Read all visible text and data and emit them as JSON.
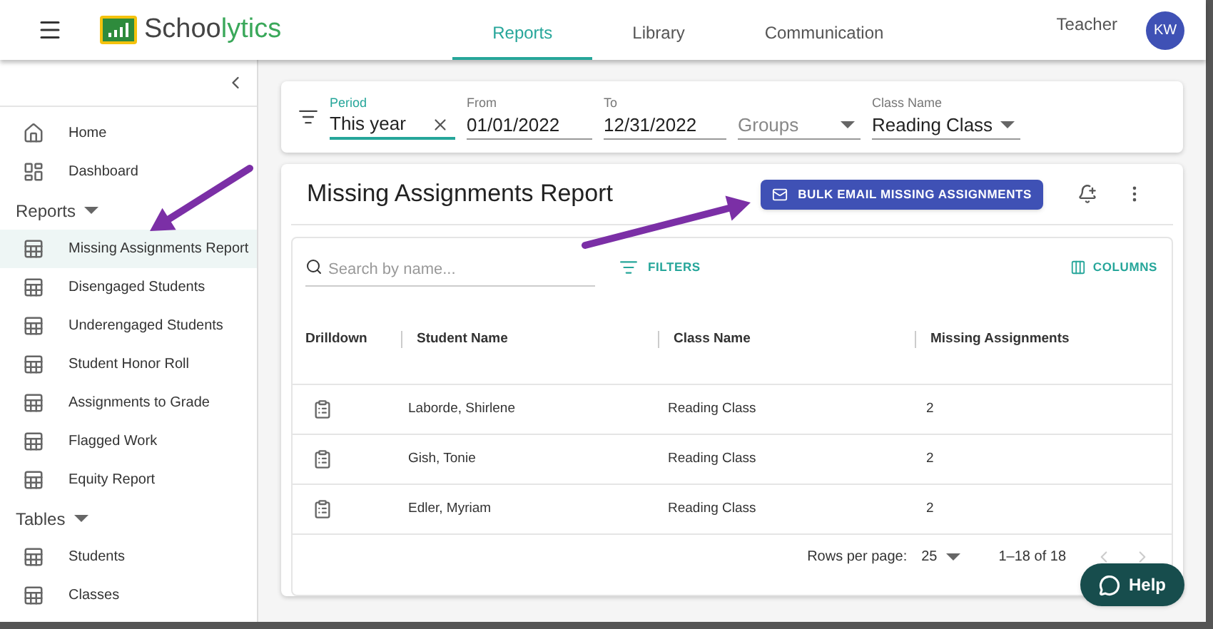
{
  "header": {
    "logo_parts": [
      "Schoo",
      "lytics"
    ],
    "tabs": [
      {
        "label": "Reports",
        "selected": true
      },
      {
        "label": "Library",
        "selected": false
      },
      {
        "label": "Communication",
        "selected": false
      }
    ],
    "role": "Teacher",
    "avatar": "KW"
  },
  "sidebar": {
    "items": [
      {
        "label": "Home",
        "kind": "home",
        "selected": false
      },
      {
        "label": "Dashboard",
        "kind": "dashboard",
        "selected": false
      }
    ],
    "sections": [
      {
        "title": "Reports",
        "expanded": true,
        "items": [
          {
            "label": "Missing Assignments Report",
            "selected": true
          },
          {
            "label": "Disengaged Students",
            "selected": false
          },
          {
            "label": "Underengaged Students",
            "selected": false
          },
          {
            "label": "Student Honor Roll",
            "selected": false
          },
          {
            "label": "Assignments to Grade",
            "selected": false
          },
          {
            "label": "Flagged Work",
            "selected": false
          },
          {
            "label": "Equity Report",
            "selected": false
          }
        ]
      },
      {
        "title": "Tables",
        "expanded": true,
        "items": [
          {
            "label": "Students",
            "selected": false
          },
          {
            "label": "Classes",
            "selected": false
          }
        ]
      }
    ]
  },
  "filters": {
    "period": {
      "label": "Period",
      "value": "This year"
    },
    "from": {
      "label": "From",
      "value": "01/01/2022"
    },
    "to": {
      "label": "To",
      "value": "12/31/2022"
    },
    "groups": {
      "placeholder": "Groups"
    },
    "class_name": {
      "label": "Class Name",
      "value": "Reading Class"
    }
  },
  "report": {
    "title": "Missing Assignments Report",
    "bulk_button": "BULK EMAIL MISSING ASSIGNMENTS",
    "search": {
      "placeholder": "Search by name..."
    },
    "filters_button": "FILTERS",
    "columns_button": "COLUMNS",
    "columns": [
      "Drilldown",
      "Student Name",
      "Class Name",
      "Missing Assignments"
    ],
    "rows": [
      {
        "student": "Laborde, Shirlene",
        "class": "Reading Class",
        "missing": "2"
      },
      {
        "student": "Gish, Tonie",
        "class": "Reading Class",
        "missing": "2"
      },
      {
        "student": "Edler, Myriam",
        "class": "Reading Class",
        "missing": "2"
      }
    ],
    "footer": {
      "rows_per_page_label": "Rows per page:",
      "rows_per_page": "25",
      "range": "1–18 of 18"
    }
  },
  "help_button": "Help"
}
